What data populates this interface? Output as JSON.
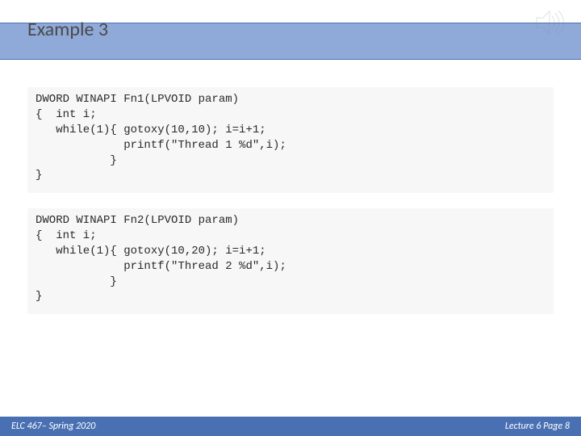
{
  "slide": {
    "title": "Example 3",
    "code1": "DWORD WINAPI Fn1(LPVOID param)\n{  int i;\n   while(1){ gotoxy(10,10); i=i+1;\n             printf(\"Thread 1 %d\",i);\n           }\n}",
    "code2": "DWORD WINAPI Fn2(LPVOID param)\n{  int i;\n   while(1){ gotoxy(10,20); i=i+1;\n             printf(\"Thread 2 %d\",i);\n           }\n}"
  },
  "footer": {
    "left": "ELC 467– Spring 2020",
    "right": "Lecture 6 Page 8"
  }
}
